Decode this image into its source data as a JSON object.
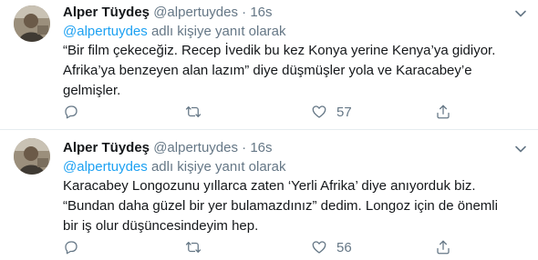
{
  "tweets": [
    {
      "name": "Alper Tüydeş",
      "handle": "@alpertuydes",
      "separator": "·",
      "time": "16s",
      "reply_handle": "@alpertuydes",
      "reply_suffix": " adlı kişiye yanıt olarak",
      "lines": [
        "“Bir film çekeceğiz. Recep İvedik bu kez Konya yerine Kenya’ya gidiyor.",
        "Afrika’ya benzeyen alan lazım” diye düşmüşler yola ve Karacabey’e",
        "gelmişler."
      ],
      "like_count": "57"
    },
    {
      "name": "Alper Tüydeş",
      "handle": "@alpertuydes",
      "separator": "·",
      "time": "16s",
      "reply_handle": "@alpertuydes",
      "reply_suffix": " adlı kişiye yanıt olarak",
      "lines": [
        "Karacabey Longozunu yıllarca zaten ‘Yerli Afrika’ diye anıyorduk biz.",
        "“Bundan daha güzel bir yer bulamazdınız” dedim. Longoz için de önemli",
        "bir iş olur düşüncesindeyim hep."
      ],
      "like_count": "56"
    }
  ],
  "icons": {
    "reply": "reply-icon",
    "retweet": "retweet-icon",
    "like": "heart-icon",
    "share": "share-icon",
    "menu": "chevron-down-icon"
  },
  "colors": {
    "link": "#1da1f2",
    "secondary_text": "#657786",
    "divider": "#e6ecf0"
  }
}
